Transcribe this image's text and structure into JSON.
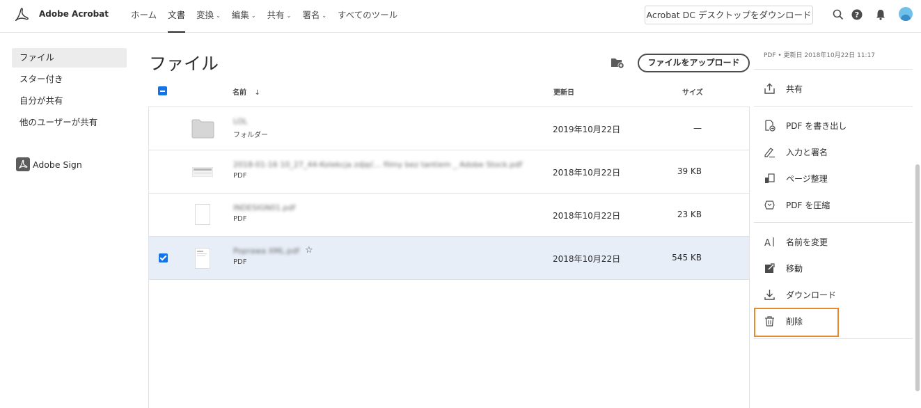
{
  "header": {
    "app_name": "Adobe Acrobat",
    "nav": [
      {
        "label": "ホーム",
        "dropdown": false
      },
      {
        "label": "文書",
        "dropdown": false,
        "active": true
      },
      {
        "label": "変換",
        "dropdown": true
      },
      {
        "label": "編集",
        "dropdown": true
      },
      {
        "label": "共有",
        "dropdown": true
      },
      {
        "label": "署名",
        "dropdown": true
      },
      {
        "label": "すべてのツール",
        "dropdown": false
      }
    ],
    "download_button": "Acrobat DC デスクトップをダウンロード",
    "icons": [
      "search-icon",
      "help-icon",
      "notification-bell-icon",
      "avatar"
    ]
  },
  "sidebar": {
    "items": [
      {
        "label": "ファイル",
        "active": true
      },
      {
        "label": "スター付き"
      },
      {
        "label": "自分が共有"
      },
      {
        "label": "他のユーザーが共有"
      }
    ],
    "adobe_sign": "Adobe Sign"
  },
  "main": {
    "title": "ファイル",
    "upload_button": "ファイルをアップロード",
    "columns": {
      "name": "名前",
      "modified": "更新日",
      "size": "サイズ"
    },
    "rows": [
      {
        "name": "LOL",
        "type": "フォルダー",
        "date": "2019年10月22日",
        "size": "—",
        "selected": false
      },
      {
        "name": "2018-01-16 10_27_44-Kolekcja zdjęć... filmy bez tantiem _ Adobe Stock.pdf",
        "type": "PDF",
        "date": "2018年10月22日",
        "size": "39 KB",
        "selected": false
      },
      {
        "name": "INDESIGN01.pdf",
        "type": "PDF",
        "date": "2018年10月22日",
        "size": "23 KB",
        "selected": false
      },
      {
        "name": "Poprawa XML.pdf",
        "type": "PDF",
        "date": "2018年10月22日",
        "size": "545 KB",
        "selected": true
      }
    ]
  },
  "right_panel": {
    "meta": "PDF  •  更新日 2018年10月22日 11:17",
    "actions": {
      "share": "共有",
      "export": "PDF を書き出し",
      "fill_sign": "入力と署名",
      "organize": "ページ整理",
      "compress": "PDF を圧縮",
      "rename": "名前を変更",
      "move": "移動",
      "download": "ダウンロード",
      "delete": "削除"
    },
    "highlight_color": "#e8892f"
  },
  "colors": {
    "accent": "#1473e6",
    "selected_row": "#e8eef8"
  }
}
